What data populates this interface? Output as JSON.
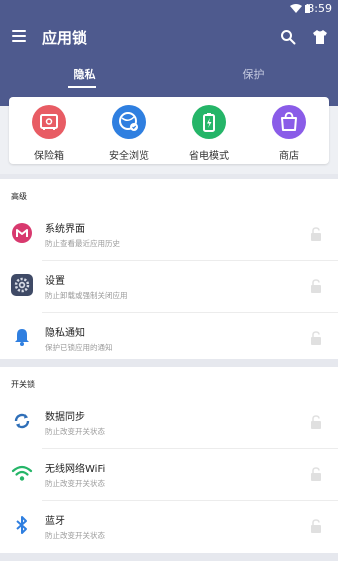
{
  "status_bar": {
    "time": "8:59"
  },
  "toolbar": {
    "title": "应用锁"
  },
  "tabs": [
    {
      "label": "隐私",
      "active": true
    },
    {
      "label": "保护",
      "active": false
    }
  ],
  "features": [
    {
      "label": "保险箱",
      "icon": "safe-icon",
      "color": "#e85c64"
    },
    {
      "label": "安全浏览",
      "icon": "browser-icon",
      "color": "#2f7fe0"
    },
    {
      "label": "省电模式",
      "icon": "battery-icon",
      "color": "#25b568"
    },
    {
      "label": "商店",
      "icon": "shop-bag-icon",
      "color": "#8a5ce8"
    }
  ],
  "sections": [
    {
      "header": "高级",
      "items": [
        {
          "title": "系统界面",
          "subtitle": "防止查看最近应用历史",
          "icon": "system-ui-icon"
        },
        {
          "title": "设置",
          "subtitle": "防止卸载或强制关闭应用",
          "icon": "settings-icon"
        },
        {
          "title": "隐私通知",
          "subtitle": "保护已锁应用的通知",
          "icon": "bell-icon"
        }
      ]
    },
    {
      "header": "开关锁",
      "items": [
        {
          "title": "数据同步",
          "subtitle": "防止改变开关状态",
          "icon": "sync-icon"
        },
        {
          "title": "无线网络WiFi",
          "subtitle": "防止改变开关状态",
          "icon": "wifi-icon"
        },
        {
          "title": "蓝牙",
          "subtitle": "防止改变开关状态",
          "icon": "bluetooth-icon"
        }
      ]
    }
  ],
  "colors": {
    "appbar": "#4e5a8e",
    "accent": "#2f7fe0"
  }
}
